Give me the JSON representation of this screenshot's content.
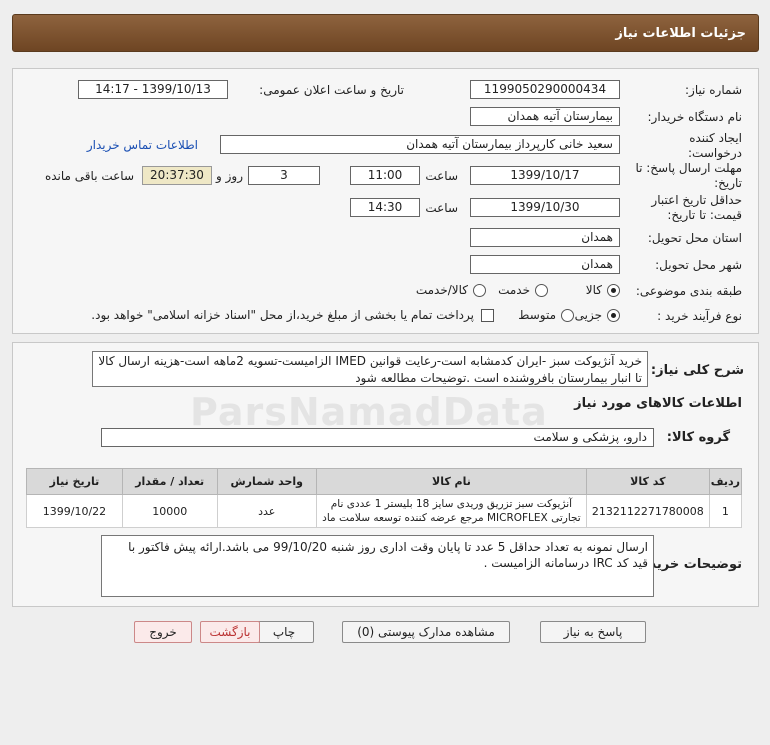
{
  "header": {
    "title": "جزئیات اطلاعات نیاز"
  },
  "info": {
    "need_number_label": "شماره نیاز:",
    "need_number": "1199050290000434",
    "announce_label": "تاریخ و ساعت اعلان عمومی:",
    "announce_value": "1399/10/13 - 14:17",
    "buyer_org_label": "نام دستگاه خریدار:",
    "buyer_org": "بیمارستان آتیه همدان",
    "creator_label": "ایجاد کننده درخواست:",
    "creator": "سعید خانی کارپرداز بیمارستان آتیه همدان",
    "contact_link": "اطلاعات تماس خریدار",
    "deadline_label": "مهلت ارسال پاسخ: تا تاریخ:",
    "deadline_date": "1399/10/17",
    "time_label": "ساعت",
    "deadline_time": "11:00",
    "days_value": "3",
    "days_label": "روز و",
    "remaining_time": "20:37:30",
    "remaining_label": "ساعت باقی مانده",
    "validity_label": "حداقل تاریخ اعتبار قیمت: تا تاریخ:",
    "validity_date": "1399/10/30",
    "validity_time": "14:30",
    "province_label": "استان محل تحویل:",
    "province": "همدان",
    "city_label": "شهر محل تحویل:",
    "city": "همدان",
    "category_label": "طبقه بندی موضوعی:",
    "category_options": [
      "کالا",
      "خدمت",
      "کالا/خدمت"
    ],
    "process_label": "نوع فرآیند خرید :",
    "process_options": [
      "جزیی",
      "متوسط"
    ],
    "payment_note": "پرداخت تمام یا بخشی از مبلغ خرید،از محل \"اسناد خزانه اسلامی\" خواهد بود."
  },
  "description": {
    "label": "شرح کلی نیاز:",
    "text_line1": "خرید آنژیوکت سبز -ایران کدمشابه است-رعایت قوانین IMED الزامیست-تسویه 2ماهه است-هزینه ارسال کالا",
    "text_line2": "تا انبار بیمارستان بافروشنده است .توضیحات مطالعه شود"
  },
  "goods": {
    "section_title": "اطلاعات کالاهای مورد نیاز",
    "group_label": "گروه کالا:",
    "group_value": "دارو، پزشکی و سلامت",
    "columns": [
      "ردیف",
      "کد کالا",
      "نام کالا",
      "واحد شمارش",
      "تعداد / مقدار",
      "تاریخ نیاز"
    ],
    "rows": [
      {
        "row": "1",
        "code": "2132112271780008",
        "name_line1": "آنژیوکت سبز تزریق وریدی سایز 18 بلیستر 1 عددی نام",
        "name_line2": "تجارتی MICROFLEX مرجع عرضه کننده توسعه سلامت ماد",
        "unit": "عدد",
        "qty": "10000",
        "date": "1399/10/22"
      }
    ]
  },
  "buyer_notes": {
    "label": "توضیحات خریدار:",
    "line1": "ارسال نمونه به تعداد حداقل 5 عدد تا پایان وقت اداری روز شنبه 99/10/20 می باشد.ارائه پیش فاکتور با",
    "line2": "قید کد IRC درسامانه الزامیست ."
  },
  "buttons": {
    "reply": "پاسخ به نیاز",
    "attachments": "مشاهده مدارک پیوستی (0)",
    "print": "چاپ",
    "back": "بازگشت",
    "exit": "خروج"
  },
  "watermark": "ParsNamadData"
}
